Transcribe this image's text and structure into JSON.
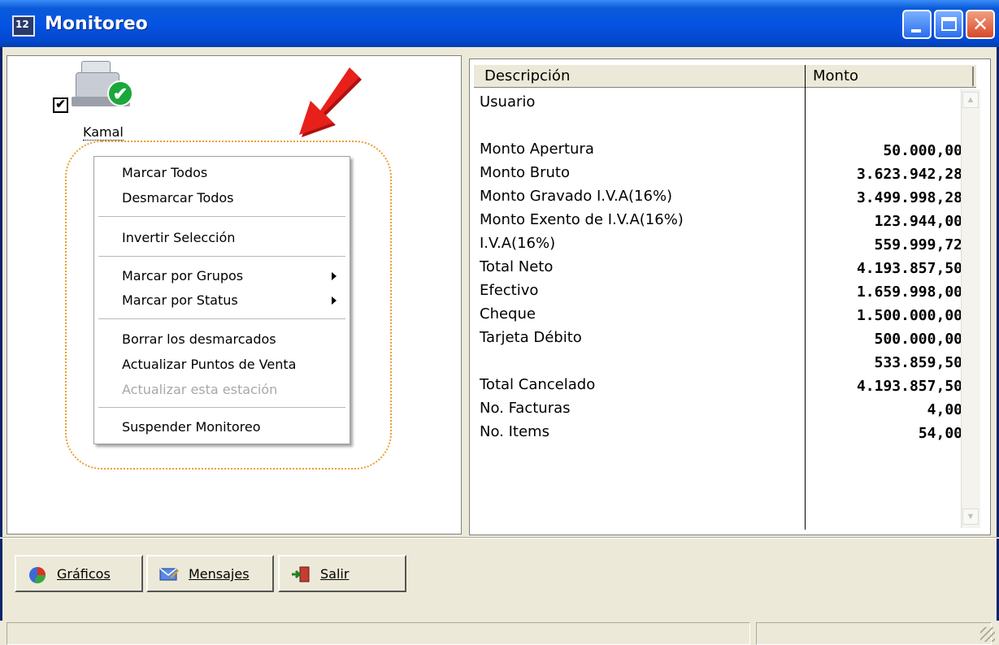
{
  "window": {
    "title": "Monitoreo",
    "app_icon": "monitor-app-icon"
  },
  "station": {
    "name": "Kamal",
    "checked": true,
    "icon": "cash-register-icon"
  },
  "context_menu": {
    "items": [
      {
        "label": "Marcar Todos"
      },
      {
        "label": "Desmarcar Todos"
      },
      {
        "label": "Invertir Selección"
      },
      {
        "label": "Marcar por Grupos",
        "submenu": true
      },
      {
        "label": "Marcar por Status",
        "submenu": true
      },
      {
        "label": "Borrar los desmarcados"
      },
      {
        "label": "Actualizar Puntos de Venta"
      },
      {
        "label": "Actualizar esta estación",
        "disabled": true
      },
      {
        "label": "Suspender Monitoreo"
      }
    ]
  },
  "grid": {
    "headers": {
      "description": "Descripción",
      "amount": "Monto"
    },
    "rows": [
      {
        "desc": "Usuario",
        "value": ""
      },
      {
        "desc": "Monto Apertura",
        "value": "50.000,00"
      },
      {
        "desc": "Monto Bruto",
        "value": "3.623.942,28"
      },
      {
        "desc": "Monto Gravado I.V.A(16%)",
        "value": "3.499.998,28"
      },
      {
        "desc": "Monto Exento de I.V.A(16%)",
        "value": "123.944,00"
      },
      {
        "desc": "I.V.A(16%)",
        "value": "559.999,72"
      },
      {
        "desc": "Total Neto",
        "value": "4.193.857,50"
      },
      {
        "desc": "Efectivo",
        "value": "1.659.998,00"
      },
      {
        "desc": "Cheque",
        "value": "1.500.000,00"
      },
      {
        "desc": "Tarjeta Débito",
        "value": "500.000,00"
      },
      {
        "desc": "",
        "value": "533.859,50"
      },
      {
        "desc": "Total Cancelado",
        "value": "4.193.857,50"
      },
      {
        "desc": "No. Facturas",
        "value": "4,00"
      },
      {
        "desc": "No. Items",
        "value": "54,00"
      }
    ]
  },
  "buttons": {
    "graficos": "Gráficos",
    "mensajes": "Mensajes",
    "salir": "Salir"
  },
  "colors": {
    "titlebar": "#0554e3",
    "arrow": "#e8201a",
    "highlight": "#e8a030"
  }
}
